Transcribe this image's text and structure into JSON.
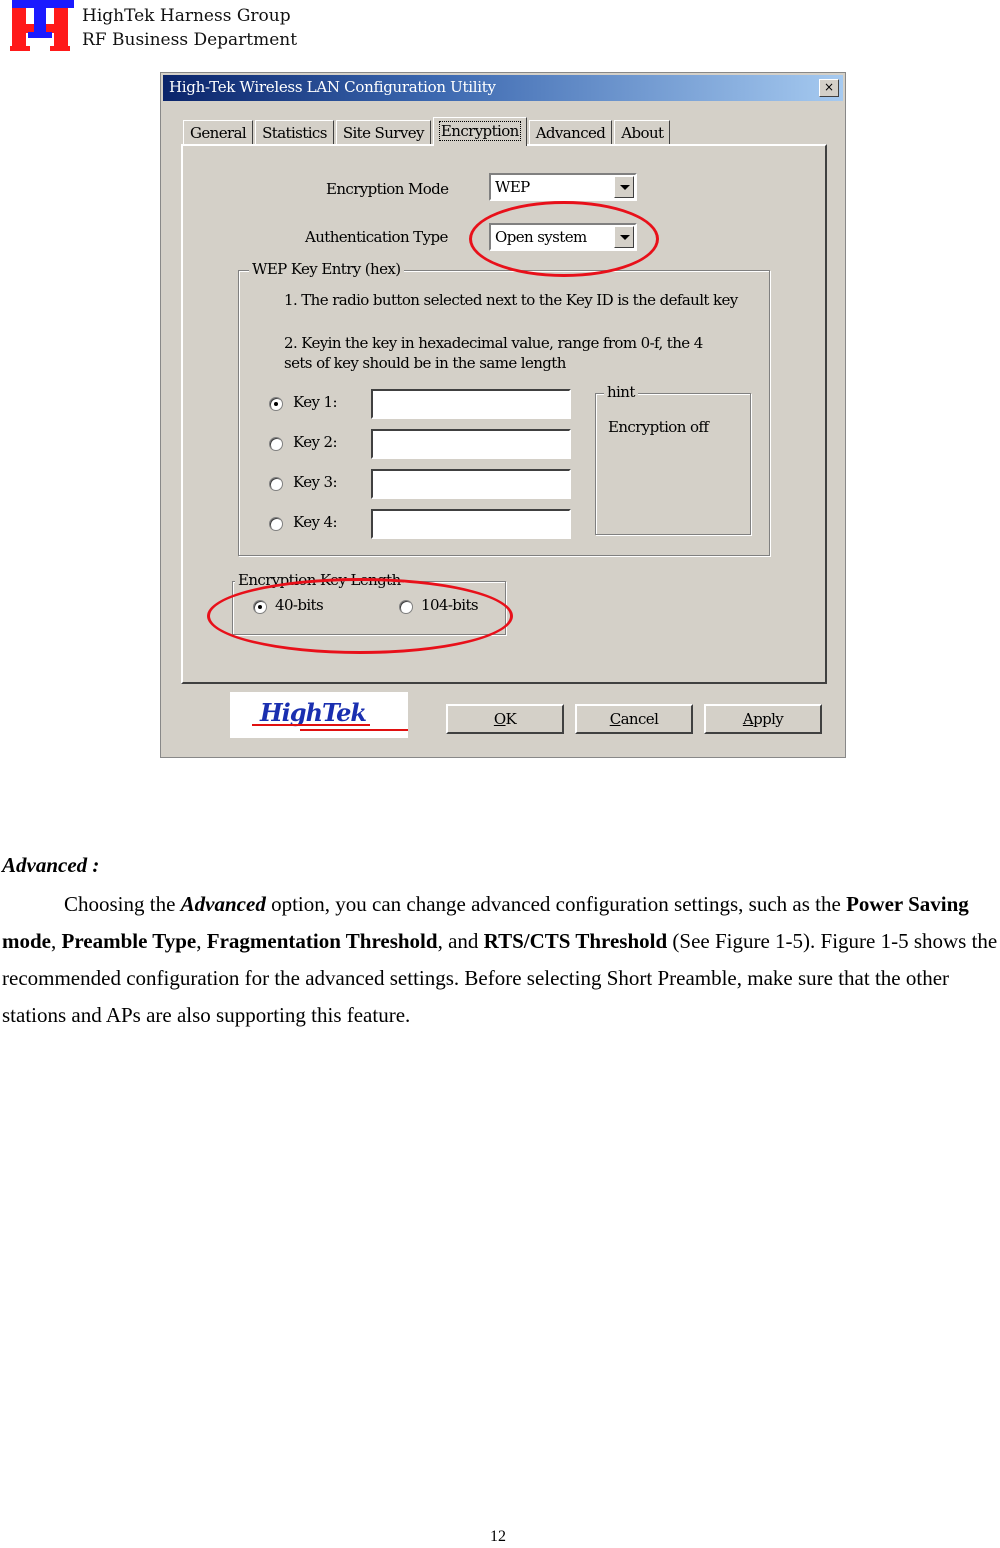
{
  "header": {
    "logo_icon": "hightek-logo-icon",
    "line1": "HighTek Harness Group",
    "line2": "RF Business Department",
    "colors": {
      "logo_red": "#ff1a1a",
      "logo_blue": "#1a1aff"
    }
  },
  "dialog": {
    "title": "High-Tek Wireless LAN Configuration Utility",
    "close_label": "×",
    "tabs": [
      {
        "label": "General"
      },
      {
        "label": "Statistics"
      },
      {
        "label": "Site Survey"
      },
      {
        "label": "Encryption",
        "active": true
      },
      {
        "label": "Advanced"
      },
      {
        "label": "About"
      }
    ],
    "encryption_mode": {
      "label": "Encryption Mode",
      "value": "WEP"
    },
    "authentication_type": {
      "label": "Authentication Type",
      "value": "Open system"
    },
    "wep_key_entry": {
      "title": "WEP Key Entry (hex)",
      "note1": "1. The radio button selected next to the Key ID is the default key",
      "note2_line1": "2. Keyin the key in hexadecimal value, range from 0-f, the 4",
      "note2_line2": "sets of key should be in the same length",
      "keys": [
        {
          "label": "Key 1:",
          "value": "",
          "selected": true
        },
        {
          "label": "Key 2:",
          "value": "",
          "selected": false
        },
        {
          "label": "Key 3:",
          "value": "",
          "selected": false
        },
        {
          "label": "Key 4:",
          "value": "",
          "selected": false
        }
      ],
      "hint": {
        "title": "hint",
        "text": "Encryption off"
      }
    },
    "key_length": {
      "title": "Encryption Key Length",
      "options": [
        {
          "label": "40-bits",
          "selected": true
        },
        {
          "label": "104-bits",
          "selected": false
        }
      ]
    },
    "brand": "HighTek",
    "buttons": {
      "ok": {
        "accel": "O",
        "rest": "K"
      },
      "cancel": {
        "accel": "C",
        "rest": "ancel"
      },
      "apply": {
        "accel": "A",
        "rest": "pply"
      }
    },
    "annotation_color": "#e8101a"
  },
  "body": {
    "heading": "Advanced :",
    "para": {
      "s1": "Choosing the ",
      "b1": "Advanced",
      "s2": " option, you can change advanced configuration settings, such as the ",
      "b2": "Power Saving mode",
      "s3": ", ",
      "b3": "Preamble Type",
      "s4": ", ",
      "b4": "Fragmentation Threshold",
      "s5": ", and ",
      "b5": "RTS/CTS Threshold",
      "s6": " (See Figure 1-5). Figure 1-5 shows the recommended configuration for the advanced settings. Before selecting Short Preamble, make sure that the other stations and APs are also supporting this feature."
    }
  },
  "footer": {
    "page_number": "12"
  }
}
